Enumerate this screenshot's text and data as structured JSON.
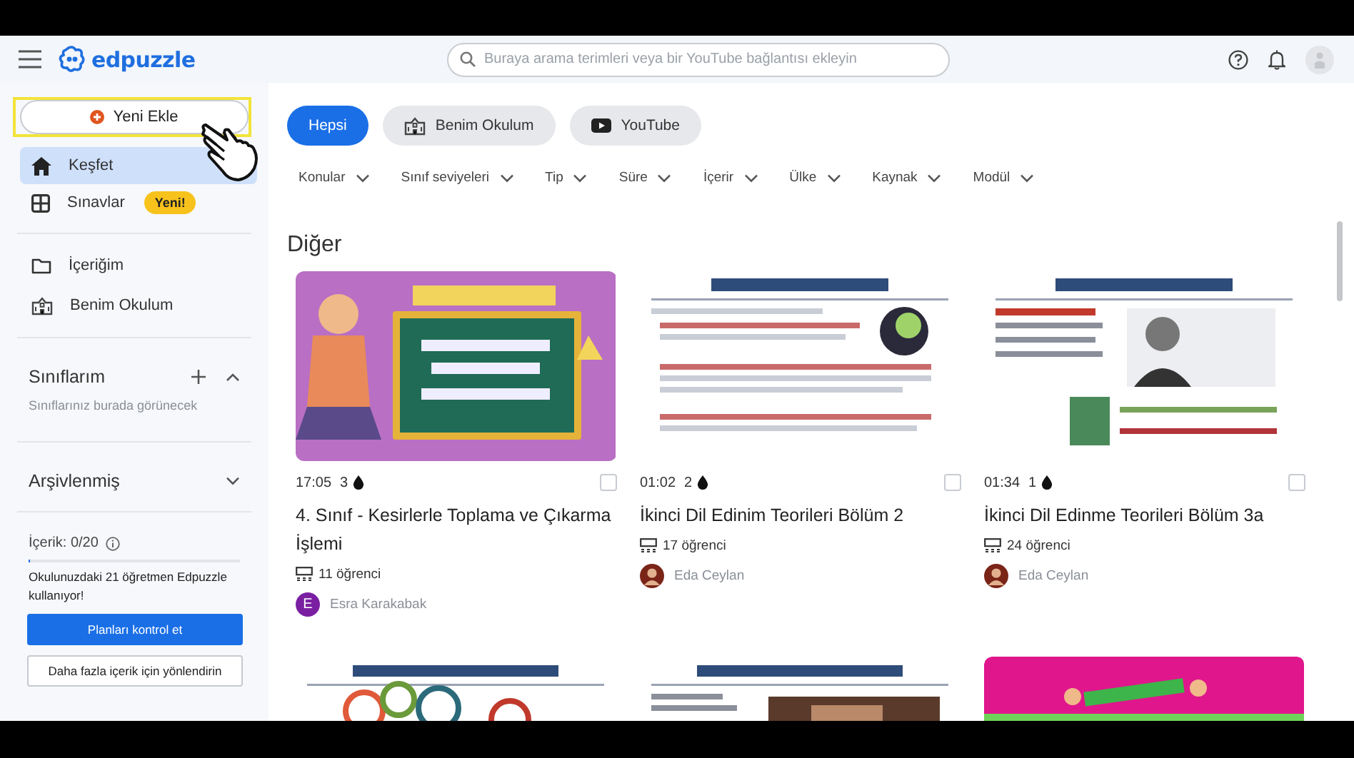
{
  "header": {
    "logo": "edpuzzle",
    "search": {
      "placeholder": "Buraya arama terimleri veya bir YouTube bağlantısı ekleyin"
    }
  },
  "sidebar": {
    "add_button": "Yeni Ekle",
    "nav": [
      {
        "kind": "home",
        "label": "Keşfet",
        "selected": true
      },
      {
        "kind": "grid",
        "label": "Sınavlar",
        "selected": false,
        "badge": "Yeni!"
      }
    ],
    "library": [
      {
        "kind": "folder",
        "label": "İçeriğim"
      },
      {
        "kind": "school",
        "label": "Benim Okulum"
      }
    ],
    "sections": [
      {
        "title": "Sınıflarım",
        "expanded": true,
        "can_add": true,
        "note": "Sınıflarınız burada görünecek"
      },
      {
        "title": "Arşivlenmiş",
        "expanded": false,
        "can_add": false
      }
    ],
    "usage": {
      "label": "İçerik: 0/20",
      "level": 0.01,
      "note": "Okulunuzdaki 21 öğretmen Edpuzzle kullanıyor!"
    },
    "buttons": [
      {
        "kind": "primary",
        "label": "Planları kontrol et"
      },
      {
        "kind": "outline",
        "label": "Daha fazla içerik için yönlendirin"
      }
    ]
  },
  "source_tabs": [
    {
      "kind": "none",
      "label": "Hepsi",
      "selected": true
    },
    {
      "kind": "school",
      "label": "Benim Okulum",
      "selected": false
    },
    {
      "kind": "youtube",
      "label": "YouTube",
      "selected": false
    }
  ],
  "filters": [
    "Konular",
    "Sınıf seviyeleri",
    "Tip",
    "Süre",
    "İçerir",
    "Ülke",
    "Kaynak",
    "Modül"
  ],
  "section_title": "Diğer",
  "cards": [
    {
      "kind": "video",
      "duration": "17:05",
      "questions": "3",
      "checked": false,
      "title": "4. Sınıf - Kesirlerle Toplama ve Çıkarma İşlemi",
      "students": "11 öğrenci",
      "author": "Esra Karakabak",
      "avatar": {
        "kind": "letter",
        "text": "E"
      }
    },
    {
      "kind": "video",
      "duration": "01:02",
      "questions": "2",
      "checked": false,
      "title": "İkinci Dil Edinim Teorileri Bölüm 2",
      "students": "17 öğrenci",
      "author": "Eda Ceylan"
    },
    {
      "kind": "video",
      "duration": "01:34",
      "questions": "1",
      "checked": false,
      "title": "İkinci Dil Edinme Teorileri Bölüm 3a",
      "students": "24 öğrenci",
      "author": "Eda Ceylan"
    },
    {
      "kind": "cut"
    },
    {
      "kind": "cut"
    },
    {
      "kind": "cut"
    }
  ]
}
